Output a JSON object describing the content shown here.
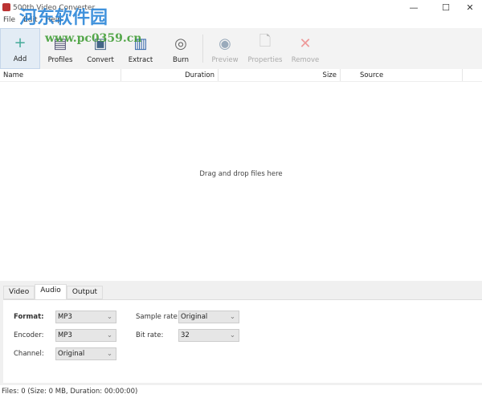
{
  "window": {
    "title": "500th Video Converter",
    "minimize": "—",
    "maximize": "☐",
    "close": "✕"
  },
  "menu": [
    "File",
    "Edit",
    "Help"
  ],
  "toolbar": [
    {
      "label": "Add",
      "icon": "add-icon",
      "glyph": "+",
      "enabled": true,
      "selected": true
    },
    {
      "label": "Profiles",
      "icon": "profiles-icon",
      "glyph": "▤",
      "enabled": true
    },
    {
      "label": "Convert",
      "icon": "convert-icon",
      "glyph": "▣",
      "enabled": true
    },
    {
      "label": "Extract",
      "icon": "extract-icon",
      "glyph": "▥",
      "enabled": true
    },
    {
      "label": "Burn",
      "icon": "disc-icon",
      "glyph": "◎",
      "enabled": true
    },
    {
      "label": "Preview",
      "icon": "eye-icon",
      "glyph": "◉",
      "enabled": false
    },
    {
      "label": "Properties",
      "icon": "properties-icon",
      "glyph": "🗋",
      "enabled": false
    },
    {
      "label": "Remove",
      "icon": "remove-icon",
      "glyph": "✕",
      "enabled": false
    }
  ],
  "columns": [
    "Name",
    "Duration",
    "Size",
    "Source"
  ],
  "drop_hint": "Drag and drop files here",
  "tabs": [
    "Video",
    "Audio",
    "Output"
  ],
  "active_tab": "Audio",
  "audio": {
    "format_label": "Format:",
    "format": "MP3",
    "encoder_label": "Encoder:",
    "encoder": "MP3",
    "channel_label": "Channel:",
    "channel": "Original",
    "sample_rate_label": "Sample rate:",
    "sample_rate": "Original",
    "bit_rate_label": "Bit rate:",
    "bit_rate": "32"
  },
  "status": "Files: 0 (Size: 0 MB, Duration: 00:00:00)",
  "watermark": {
    "text": "河东软件园",
    "url": "www.pc0359.cn"
  }
}
